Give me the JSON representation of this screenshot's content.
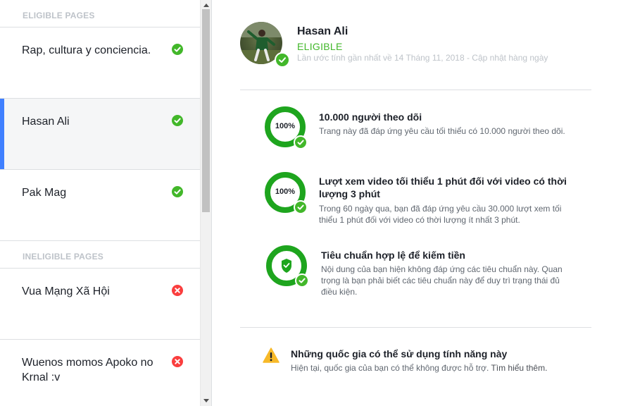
{
  "sidebar": {
    "eligible_header": "ELIGIBLE PAGES",
    "ineligible_header": "INELIGIBLE PAGES",
    "eligible_pages": [
      {
        "name": "Rap, cultura y conciencia.",
        "status": "eligible"
      },
      {
        "name": "Hasan Ali",
        "status": "eligible",
        "selected": true
      },
      {
        "name": "Pak Mag",
        "status": "eligible"
      }
    ],
    "ineligible_pages": [
      {
        "name": "Vua Mạng Xã Hội",
        "status": "ineligible"
      },
      {
        "name": "Wuenos momos Apoko no Krnal :v",
        "status": "ineligible"
      }
    ]
  },
  "profile": {
    "name": "Hasan Ali",
    "status": "ELIGIBLE",
    "meta": "Lần ước tính gần nhất về 14 Tháng 11, 2018 - Cập nhật hàng ngày"
  },
  "requirements": [
    {
      "percent": "100%",
      "title": "10.000 người theo dõi",
      "description": "Trang này đã đáp ứng yêu cầu tối thiểu có 10.000 người theo dõi."
    },
    {
      "percent": "100%",
      "title": "Lượt xem video tối thiểu 1 phút đối với video có thời lượng 3 phút",
      "description": "Trong 60 ngày qua, bạn đã đáp ứng yêu cầu 30.000 lượt xem tối thiểu 1 phút đối với video có thời lượng ít nhất 3 phút."
    },
    {
      "icon": "shield-icon",
      "title": "Tiêu chuẩn hợp lệ để kiếm tiền",
      "description": "Nội dung của bạn hiện không đáp ứng các tiêu chuẩn này. Quan trọng là bạn phải biết các tiêu chuẩn này để duy trì trạng thái đủ điều kiện."
    }
  ],
  "notice": {
    "title": "Những quốc gia có thể sử dụng tính năng này",
    "description": "Hiện tại, quốc gia của bạn có thể không được hỗ trợ.",
    "link": "Tìm hiểu thêm."
  },
  "colors": {
    "green": "#42b72a",
    "ring_green": "#1ea51e",
    "red": "#fa3e3e",
    "accent_blue": "#4080ff",
    "warning_yellow": "#f7b928"
  }
}
